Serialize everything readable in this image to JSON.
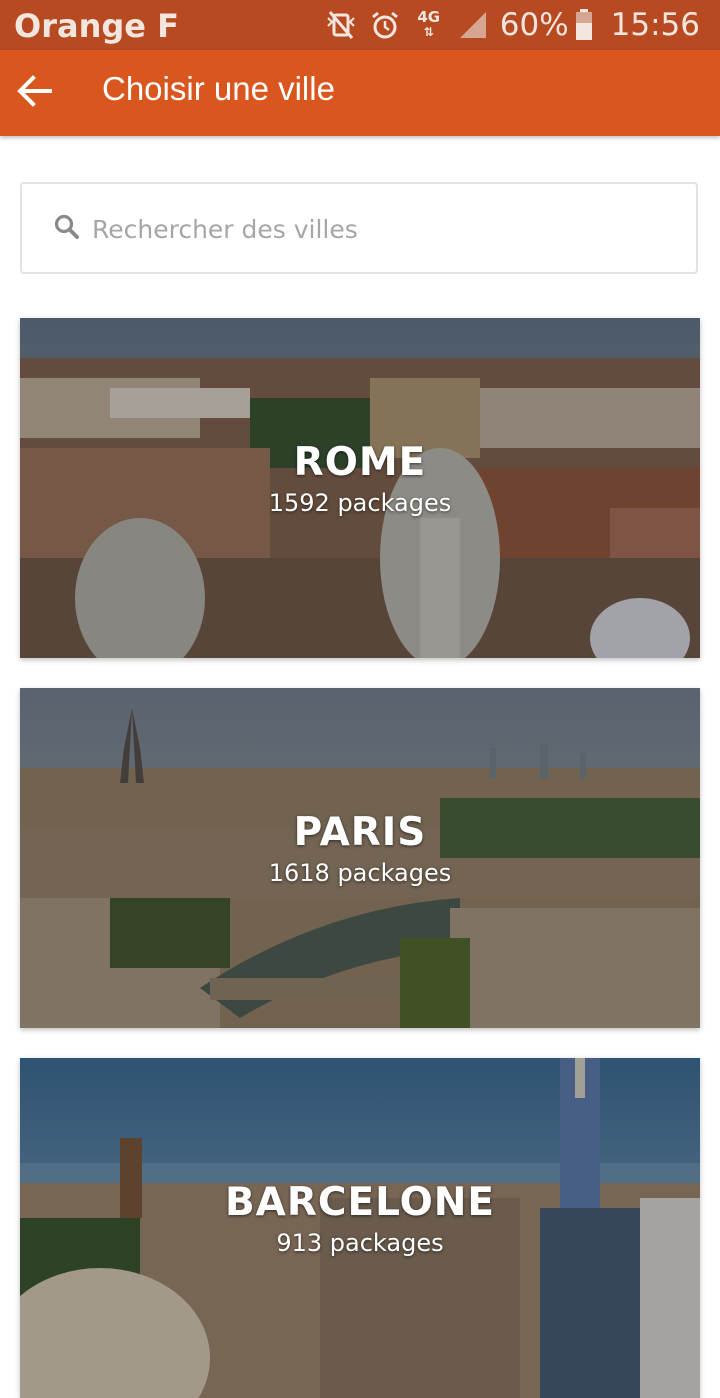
{
  "status_bar": {
    "carrier": "Orange F",
    "network_label": "4G",
    "battery": "60%",
    "time": "15:56"
  },
  "toolbar": {
    "title": "Choisir une ville"
  },
  "search": {
    "placeholder": "Rechercher des villes",
    "value": ""
  },
  "cities": [
    {
      "name": "ROME",
      "packages": "1592 packages"
    },
    {
      "name": "PARIS",
      "packages": "1618 packages"
    },
    {
      "name": "BARCELONE",
      "packages": "913 packages"
    }
  ],
  "colors": {
    "status_bar": "#b84a22",
    "toolbar": "#d9571f",
    "background": "#ffffff"
  }
}
